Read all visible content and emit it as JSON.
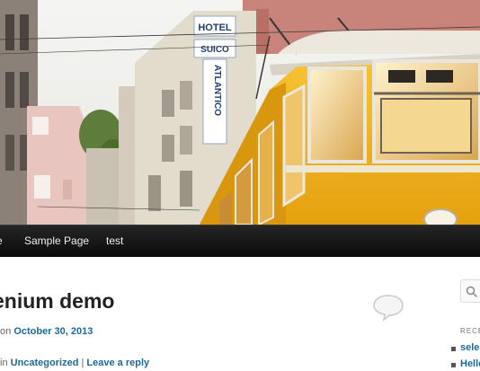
{
  "nav": {
    "items": [
      {
        "label": "e"
      },
      {
        "label": "Sample Page"
      },
      {
        "label": "test"
      }
    ]
  },
  "post": {
    "title": "enium demo",
    "date_prefix": "on",
    "date": "October 30, 2013",
    "category_prefix": "in",
    "category": "Uncategorized",
    "separator": "|",
    "reply": "Leave a reply"
  },
  "sidebar": {
    "recent_title": "RECE",
    "recent_items": [
      "sele",
      "Hello"
    ]
  },
  "header_image": {
    "sign_hotel": "HOTEL",
    "sign_name": "SUICO",
    "sign_vertical": "ATLANTICO",
    "tram_color": "#f2b21c"
  }
}
